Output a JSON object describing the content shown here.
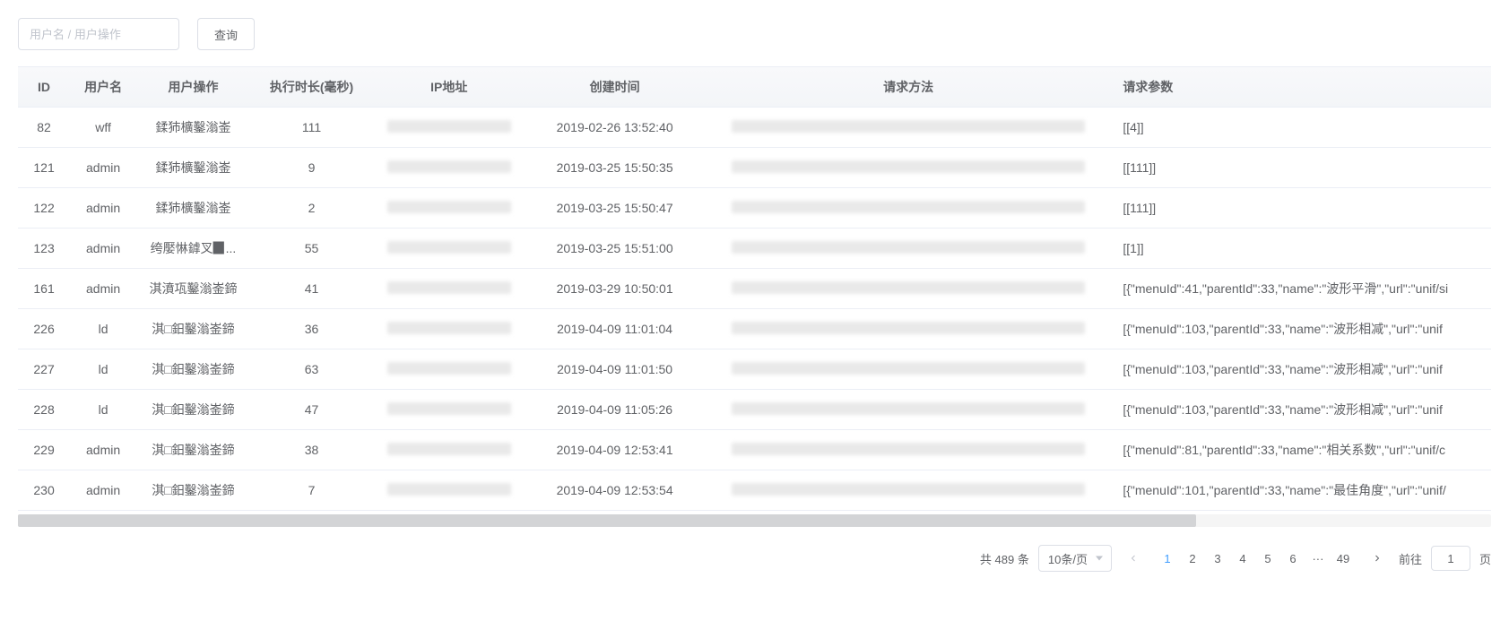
{
  "toolbar": {
    "search_placeholder": "用户名 / 用户操作",
    "query_label": "查询"
  },
  "table": {
    "columns": [
      {
        "key": "id",
        "label": "ID"
      },
      {
        "key": "user",
        "label": "用户名"
      },
      {
        "key": "op",
        "label": "用户操作"
      },
      {
        "key": "dur",
        "label": "执行时长(毫秒)"
      },
      {
        "key": "ip",
        "label": "IP地址"
      },
      {
        "key": "time",
        "label": "创建时间"
      },
      {
        "key": "method",
        "label": "请求方法"
      },
      {
        "key": "param",
        "label": "请求参数"
      }
    ],
    "rows": [
      {
        "id": "82",
        "user": "wff",
        "op": "鍒犻櫎鑿滃崟",
        "dur": "111",
        "time": "2019-02-26 13:52:40",
        "param": "[[4]]"
      },
      {
        "id": "121",
        "user": "admin",
        "op": "鍒犻櫎鑿滃崟",
        "dur": "9",
        "time": "2019-03-25 15:50:35",
        "param": "[[111]]"
      },
      {
        "id": "122",
        "user": "admin",
        "op": "鍒犻櫎鑿滃崟",
        "dur": "2",
        "time": "2019-03-25 15:50:47",
        "param": "[[111]]"
      },
      {
        "id": "123",
        "user": "admin",
        "op": "绔嬮惏鎼叉▉...",
        "dur": "55",
        "time": "2019-03-25 15:51:00",
        "param": "[[1]]"
      },
      {
        "id": "161",
        "user": "admin",
        "op": "淇濆瓨鑿滃崟鍗",
        "dur": "41",
        "time": "2019-03-29 10:50:01",
        "param": "[{\"menuId\":41,\"parentId\":33,\"name\":\"波形平滑\",\"url\":\"unif/si"
      },
      {
        "id": "226",
        "user": "ld",
        "op": "淇□鈤鑿滃崟鍗",
        "dur": "36",
        "time": "2019-04-09 11:01:04",
        "param": "[{\"menuId\":103,\"parentId\":33,\"name\":\"波形相减\",\"url\":\"unif"
      },
      {
        "id": "227",
        "user": "ld",
        "op": "淇□鈤鑿滃崟鍗",
        "dur": "63",
        "time": "2019-04-09 11:01:50",
        "param": "[{\"menuId\":103,\"parentId\":33,\"name\":\"波形相减\",\"url\":\"unif"
      },
      {
        "id": "228",
        "user": "ld",
        "op": "淇□鈤鑿滃崟鍗",
        "dur": "47",
        "time": "2019-04-09 11:05:26",
        "param": "[{\"menuId\":103,\"parentId\":33,\"name\":\"波形相减\",\"url\":\"unif"
      },
      {
        "id": "229",
        "user": "admin",
        "op": "淇□鈤鑿滃崟鍗",
        "dur": "38",
        "time": "2019-04-09 12:53:41",
        "param": "[{\"menuId\":81,\"parentId\":33,\"name\":\"相关系数\",\"url\":\"unif/c"
      },
      {
        "id": "230",
        "user": "admin",
        "op": "淇□鈤鑿滃崟鍗",
        "dur": "7",
        "time": "2019-04-09 12:53:54",
        "param": "[{\"menuId\":101,\"parentId\":33,\"name\":\"最佳角度\",\"url\":\"unif/"
      }
    ]
  },
  "pagination": {
    "total_label_prefix": "共",
    "total": "489",
    "total_label_suffix": "条",
    "page_size_label": "10条/页",
    "pages": [
      "1",
      "2",
      "3",
      "4",
      "5",
      "6",
      "···",
      "49"
    ],
    "current": "1",
    "goto_prefix": "前往",
    "goto_value": "1",
    "goto_suffix": "页"
  }
}
